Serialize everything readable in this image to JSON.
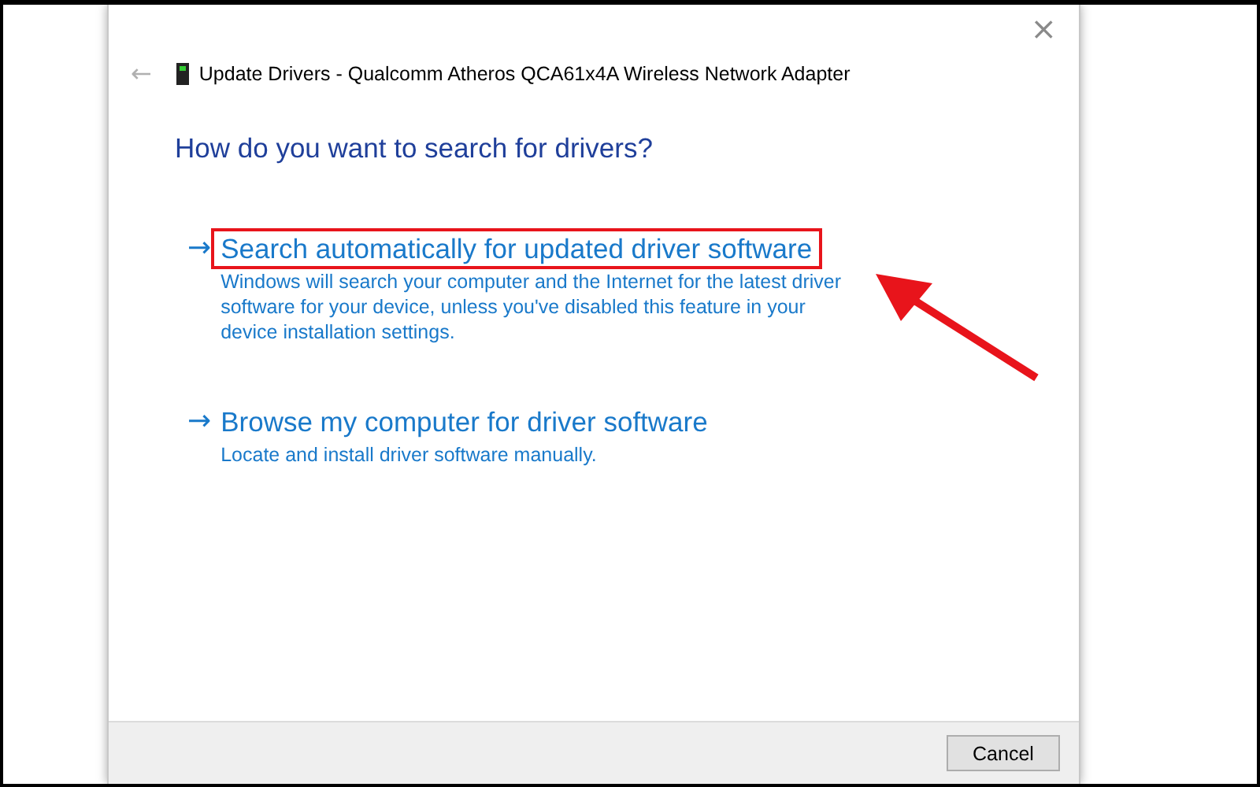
{
  "window": {
    "title": "Update Drivers - Qualcomm Atheros QCA61x4A Wireless Network Adapter",
    "close": "×",
    "back": "←"
  },
  "heading": "How do you want to search for drivers?",
  "options": [
    {
      "arrow": "→",
      "title": "Search automatically for updated driver software",
      "description": "Windows will search your computer and the Internet for the latest driver software for your device, unless you've disabled this feature in your device installation settings.",
      "highlighted": true
    },
    {
      "arrow": "→",
      "title": "Browse my computer for driver software",
      "description": "Locate and install driver software manually.",
      "highlighted": false
    }
  ],
  "buttons": [
    "Cancel"
  ]
}
